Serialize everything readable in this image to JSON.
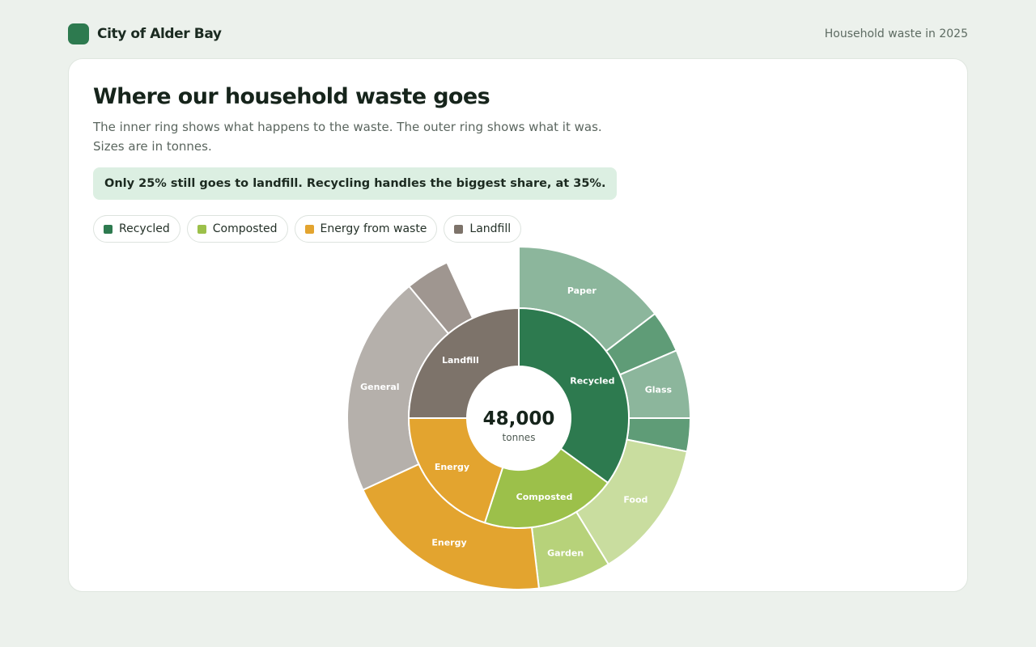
{
  "header": {
    "brand_name": "City of Alder Bay",
    "context": "Household waste in 2025"
  },
  "colors": {
    "brand": "#2d7a4f",
    "recycled": "#2d7a4f",
    "composted": "#9cc04a",
    "energy": "#e3a42f",
    "landfill": "#7d736a"
  },
  "card": {
    "title": "Where our household waste goes",
    "subtitle": "The inner ring shows what happens to the waste. The outer ring shows what it was. Sizes are in tonnes.",
    "callout": "Only 25% still goes to landfill. Recycling handles the biggest share, at 35%."
  },
  "legend": [
    {
      "label": "Recycled",
      "color": "#2d7a4f"
    },
    {
      "label": "Composted",
      "color": "#9cc04a"
    },
    {
      "label": "Energy from waste",
      "color": "#e3a42f"
    },
    {
      "label": "Landfill",
      "color": "#7d736a"
    }
  ],
  "chart_data": {
    "type": "sunburst",
    "center": {
      "value": "48,000",
      "unit": "tonnes"
    },
    "inner": [
      {
        "name": "Recycled",
        "label": "Recycled",
        "value": 16800,
        "color": "#2d7a4f"
      },
      {
        "name": "Composted",
        "label": "Composted",
        "value": 9600,
        "color": "#9cc04a"
      },
      {
        "name": "Energy from waste",
        "label": "Energy",
        "value": 9600,
        "color": "#e3a42f"
      },
      {
        "name": "Landfill",
        "label": "Landfill",
        "value": 12000,
        "color": "#7d736a"
      }
    ],
    "outer": [
      {
        "parent": "Recycled",
        "label": "Paper",
        "value": 7000,
        "color": "#8cb69c"
      },
      {
        "parent": "Recycled",
        "label": "",
        "value": 1900,
        "color": "#5f9c77"
      },
      {
        "parent": "Recycled",
        "label": "Glass",
        "value": 3100,
        "color": "#8cb69c"
      },
      {
        "parent": "Recycled",
        "label": "",
        "value": 1500,
        "color": "#5f9c77"
      },
      {
        "parent": "Composted",
        "label": "Food",
        "value": 6300,
        "color": "#c9dd9f"
      },
      {
        "parent": "Composted",
        "label": "Garden",
        "value": 3300,
        "color": "#b7d27a"
      },
      {
        "parent": "Energy from waste",
        "label": "Energy",
        "value": 9600,
        "color": "#e3a42f"
      },
      {
        "parent": "Landfill",
        "label": "General",
        "value": 10000,
        "color": "#b5b0ab"
      },
      {
        "parent": "Landfill",
        "label": "",
        "value": 2000,
        "color": "#9f9690"
      }
    ]
  }
}
